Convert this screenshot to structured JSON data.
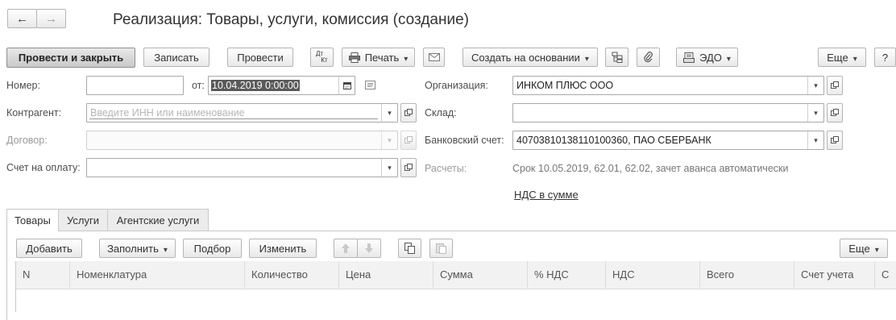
{
  "window": {
    "title": "Реализация: Товары, услуги, комиссия (создание)",
    "back_icon": "←",
    "forward_icon": "→"
  },
  "toolbar": {
    "post_and_close": "Провести и закрыть",
    "save": "Записать",
    "post": "Провести",
    "dt_kt_top": "Дт",
    "dt_kt_bottom": "Кт",
    "print": "Печать",
    "create_based_on": "Создать на основании",
    "edo": "ЭДО",
    "more": "Еще",
    "help": "?"
  },
  "form": {
    "number_label": "Номер:",
    "number_value": "",
    "date_from_label": "от:",
    "date_value": "10.04.2019  0:00:00",
    "counterparty_label": "Контрагент:",
    "counterparty_placeholder": "Введите ИНН или наименование",
    "contract_label": "Договор:",
    "contract_value": "",
    "invoice_label": "Счет на оплату:",
    "invoice_value": "",
    "organization_label": "Организация:",
    "organization_value": "ИНКОМ ПЛЮС ООО",
    "warehouse_label": "Склад:",
    "warehouse_value": "",
    "bank_account_label": "Банковский счет:",
    "bank_account_value": "40703810138110100360, ПАО СБЕРБАНК",
    "settlements_label": "Расчеты:",
    "settlements_value": "Срок 10.05.2019, 62.01, 62.02, зачет аванса автоматически",
    "vat_link": "НДС в сумме"
  },
  "tabs": [
    {
      "label": "Товары",
      "active": true
    },
    {
      "label": "Услуги",
      "active": false
    },
    {
      "label": "Агентские услуги",
      "active": false
    }
  ],
  "table_toolbar": {
    "add": "Добавить",
    "fill": "Заполнить",
    "selection": "Подбор",
    "change": "Изменить",
    "more": "Еще"
  },
  "table": {
    "columns": [
      "N",
      "Номенклатура",
      "Количество",
      "Цена",
      "Сумма",
      "% НДС",
      "НДС",
      "Всего",
      "Счет учета",
      "С"
    ]
  }
}
